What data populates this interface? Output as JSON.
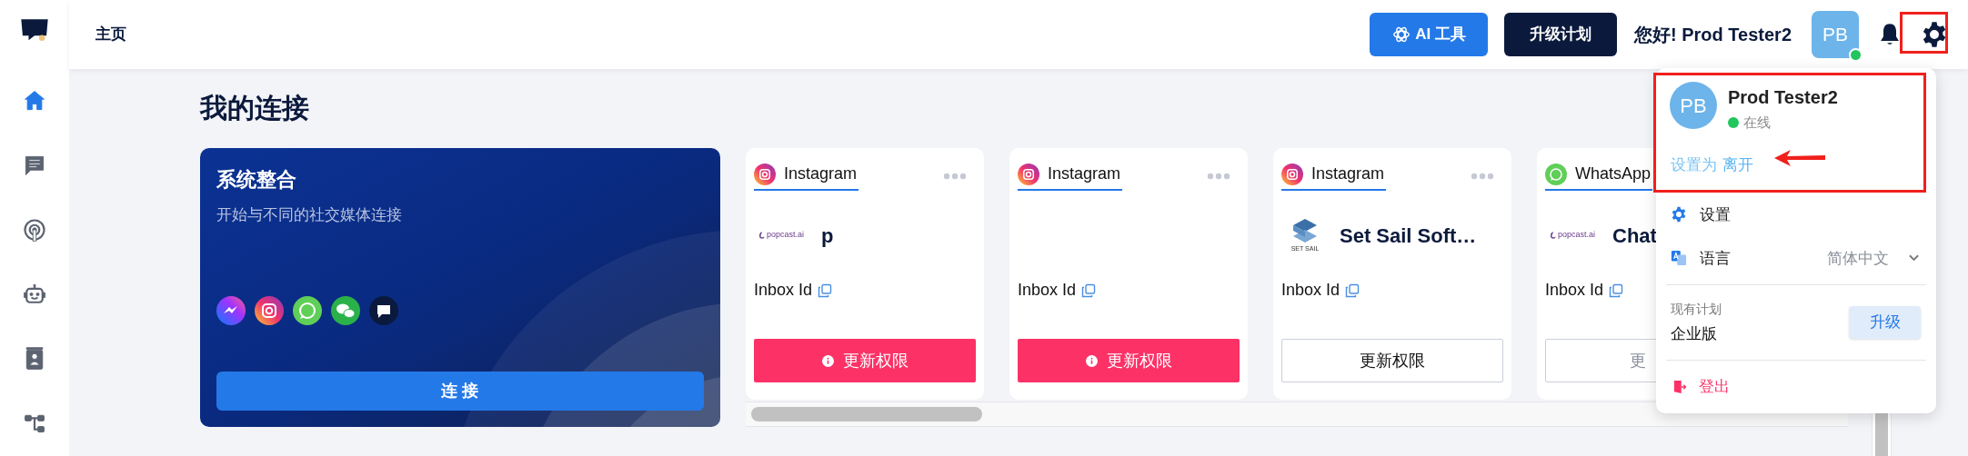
{
  "sidebar": {
    "items": [
      {
        "selected": true
      },
      {
        "selected": false
      },
      {
        "selected": false
      },
      {
        "selected": false
      },
      {
        "selected": false
      },
      {
        "selected": false
      }
    ]
  },
  "header": {
    "title": "主页",
    "ai_button": "AI 工具",
    "upgrade_button": "升级计划",
    "greeting": "您好! Prod Tester2",
    "avatar": "PB",
    "online": true
  },
  "page_title": "我的连接",
  "integration_card": {
    "title": "系统整合",
    "subtitle": "开始与不同的社交媒体连接",
    "button": "连 接"
  },
  "connections": [
    {
      "platform": {
        "kind": "instagram",
        "label": "Instagram"
      },
      "logo": {
        "kind": "popcast",
        "text": "popcast.ai"
      },
      "name": "p",
      "more_menu": true,
      "inbox_label": "Inbox Id",
      "button": {
        "kind": "alert",
        "label": "更新权限"
      }
    },
    {
      "platform": {
        "kind": "instagram",
        "label": "Instagram"
      },
      "more_menu": true,
      "inbox_label": "Inbox Id",
      "button": {
        "kind": "alert",
        "label": "更新权限"
      }
    },
    {
      "platform": {
        "kind": "instagram",
        "label": "Instagram"
      },
      "logo": {
        "kind": "setsail",
        "text": "SET SAIL"
      },
      "name": "Set Sail Soft…",
      "more_menu": true,
      "inbox_label": "Inbox Id",
      "button": {
        "kind": "normal",
        "label": "更新权限"
      }
    },
    {
      "platform": {
        "kind": "whatsapp",
        "label": "WhatsApp"
      },
      "logo": {
        "kind": "popcast",
        "text": "popcast.ai"
      },
      "name": "Chat",
      "inbox_label": "Inbox Id",
      "button": {
        "kind": "faded",
        "label": "更"
      }
    }
  ],
  "user_menu": {
    "avatar": "PB",
    "name": "Prod Tester2",
    "status": "在线",
    "online": true,
    "set_status_prefix": "设置为",
    "set_status_link": "离开",
    "items": [
      {
        "label": "设置",
        "kind": "settings"
      },
      {
        "label": "语言",
        "kind": "language",
        "value": "简体中文"
      }
    ],
    "plan_label": "现有计划",
    "plan": "企业版",
    "plan_button": "升级",
    "logout": "登出"
  }
}
